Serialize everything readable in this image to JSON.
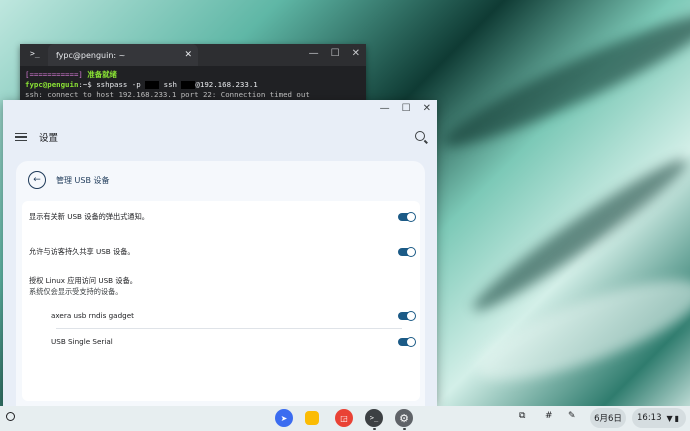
{
  "terminal": {
    "tab_title": "fypc@penguin: ~",
    "icon": ">_",
    "close": "✕",
    "controls": [
      "—",
      "☐",
      "✕"
    ],
    "line1_bar": "[===========]",
    "line1_text": "准备就绪",
    "line2_prompt": "fypc@penguin",
    "line2_path": ":~$",
    "line2_cmd_a": " sshpass -p",
    "line2_cmd_b": " ssh ",
    "line2_cmd_c": "@192.168.233.1",
    "line3": "ssh: connect to host 192.168.233.1 port 22: Connection timed out"
  },
  "settings": {
    "controls": [
      "—",
      "☐",
      "✕"
    ],
    "title": "设置",
    "page_title": "管理 USB 设备",
    "back_icon": "←",
    "row1": "显示有关新 USB 设备的弹出式通知。",
    "row2": "允许与访客持久共享 USB 设备。",
    "row3_line1": "授权 Linux 应用访问 USB 设备。",
    "row3_line2": "系统仅会显示受支持的设备。",
    "device1": "axera usb rndis gadget",
    "device2": "USB Single Serial",
    "toggles": {
      "row1": true,
      "row2": true,
      "device1": true,
      "device2": true
    }
  },
  "shelf": {
    "apps": [
      "gemini-app",
      "files-app",
      "screenshot-app",
      "terminal-app",
      "settings-app"
    ],
    "terminal_glyph": ">_",
    "date": "6月6日",
    "time": "16:13",
    "tray_icons": [
      "windows-icon",
      "hash-icon",
      "pen-icon",
      "wifi-icon",
      "battery-icon"
    ]
  },
  "colors": {
    "accent": "#1b5a86",
    "window_bg": "#e8eef7",
    "terminal_bg": "#202124"
  }
}
